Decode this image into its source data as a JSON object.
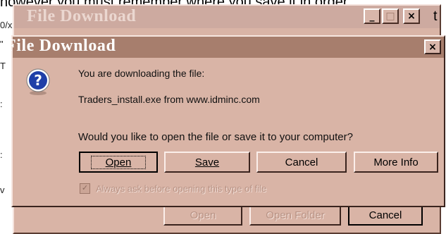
{
  "background": {
    "page_text": "however you must remember where you save it in order",
    "left_fragments": [
      "0/x",
      "\"",
      "T",
      ":",
      ":",
      "v"
    ],
    "right_fragment": "t"
  },
  "back_window": {
    "title": "File Download",
    "minimize_label": "_",
    "maximize_label": "□",
    "close_label": "×",
    "buttons": {
      "open": "Open",
      "open_folder": "Open Folder",
      "cancel": "Cancel"
    }
  },
  "dialog": {
    "title": "File Download",
    "close_label": "×",
    "line1": "You are downloading the file:",
    "line2": "Traders_install.exe from www.idminc.com",
    "question": "Would you like to open the file or save it to your computer?",
    "buttons": {
      "open": "Open",
      "save": "Save",
      "cancel": "Cancel",
      "more_info": "More Info"
    },
    "checkbox": {
      "label": "Always ask before opening this type of file",
      "checked": true
    }
  }
}
